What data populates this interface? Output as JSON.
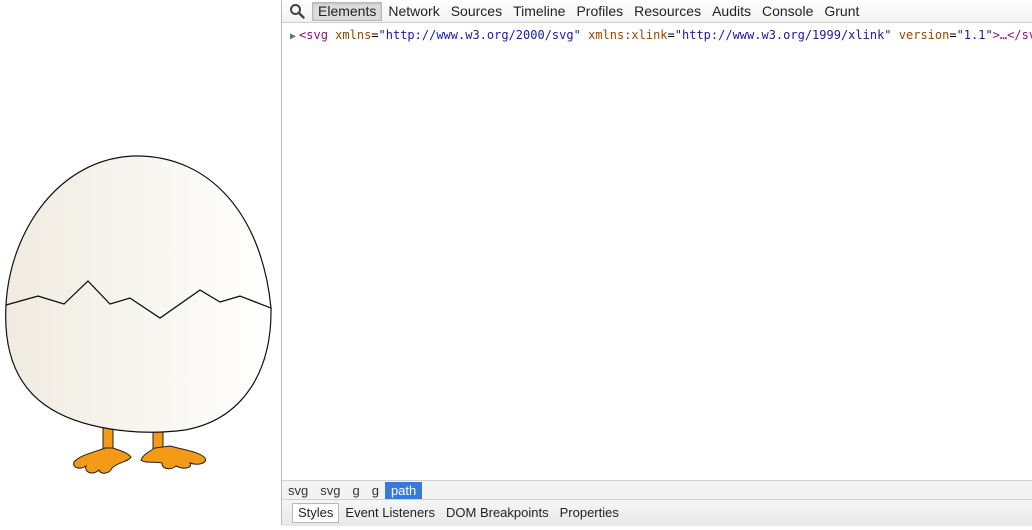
{
  "toolbar": {
    "search_icon": "magnifier-icon",
    "tabs": [
      {
        "label": "Elements",
        "selected": true
      },
      {
        "label": "Network"
      },
      {
        "label": "Sources"
      },
      {
        "label": "Timeline"
      },
      {
        "label": "Profiles"
      },
      {
        "label": "Resources"
      },
      {
        "label": "Audits"
      },
      {
        "label": "Console"
      },
      {
        "label": "Grunt"
      }
    ]
  },
  "dom_tree": {
    "line1": {
      "open": "<svg",
      "attr1_name": "xmlns",
      "attr1_value": "\"http://www.w3.org/2000/svg\"",
      "attr2_name": "xmlns:xlink",
      "attr2_value": "\"http://www.w3.org/1999/xlink\"",
      "attr3_name": "version",
      "attr3_value": "\"1.1\"",
      "close": ">…</svg>"
    }
  },
  "breadcrumbs": [
    {
      "label": "svg"
    },
    {
      "label": "svg"
    },
    {
      "label": "g"
    },
    {
      "label": "g"
    },
    {
      "label": "path",
      "selected": true
    }
  ],
  "sidebar_tabs": [
    {
      "label": "Styles",
      "selected": true
    },
    {
      "label": "Event Listeners"
    },
    {
      "label": "DOM Breakpoints"
    },
    {
      "label": "Properties"
    }
  ],
  "colors": {
    "egg_fill": "#f3f0e8",
    "feet": "#f59a16",
    "selected_crumb": "#3879d9"
  }
}
